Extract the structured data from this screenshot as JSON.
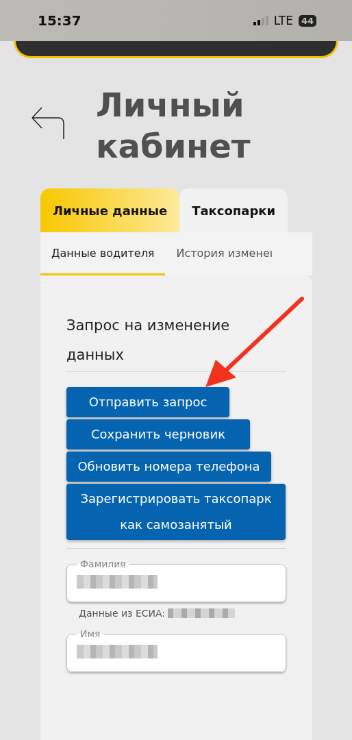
{
  "status_bar": {
    "time": "15:37",
    "network": "LTE",
    "battery": "44"
  },
  "title": "Личный кабинет",
  "tabs": [
    {
      "label": "Личные данные",
      "selected": true
    },
    {
      "label": "Таксопарки",
      "selected": false
    }
  ],
  "subtabs": [
    {
      "label": "Данные водителя",
      "selected": true
    },
    {
      "label": "История изменеı",
      "selected": false
    }
  ],
  "section_title": "Запрос на изменение данных",
  "buttons": [
    {
      "label": "Отправить запрос"
    },
    {
      "label": "Сохранить черновик"
    },
    {
      "label": "Обновить номера телефона"
    },
    {
      "label": "Зарегистрировать таксопарк как самозанятый"
    }
  ],
  "fields": [
    {
      "label": "Фамилия",
      "helper": "Данные из ЕСИА:"
    },
    {
      "label": "Имя"
    }
  ]
}
